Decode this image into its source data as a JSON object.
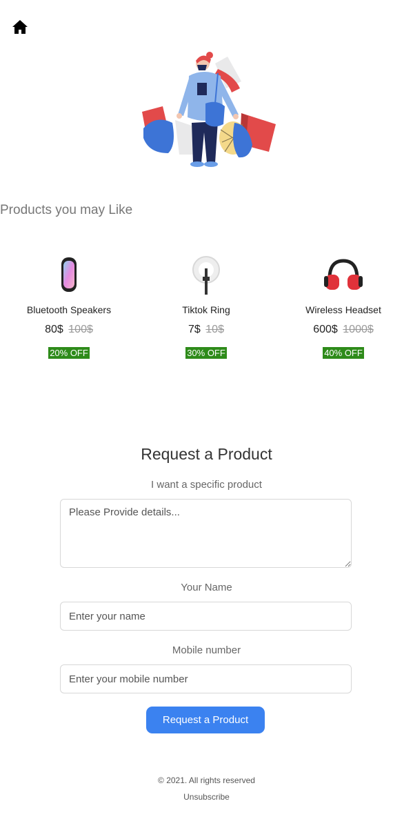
{
  "header": {
    "home_icon": "home-icon"
  },
  "hero": {
    "illustration": "shopping-woman-illustration"
  },
  "products_section": {
    "title": "Products you may Like",
    "items": [
      {
        "name": "Bluetooth Speakers",
        "price": "80$",
        "old_price": "100$",
        "discount": "20% OFF",
        "icon": "speaker-icon"
      },
      {
        "name": "Tiktok Ring",
        "price": "7$",
        "old_price": "10$",
        "discount": "30% OFF",
        "icon": "ring-light-icon"
      },
      {
        "name": "Wireless Headset",
        "price": "600$",
        "old_price": "1000$",
        "discount": "40% OFF",
        "icon": "headset-icon"
      }
    ],
    "badge_color": "#2e8b1a"
  },
  "request_form": {
    "title": "Request a Product",
    "details_label": "I want a specific product",
    "details_placeholder": "Please Provide details...",
    "name_label": "Your Name",
    "name_placeholder": "Enter your name",
    "mobile_label": "Mobile number",
    "mobile_placeholder": "Enter your mobile number",
    "submit_label": "Request a Product",
    "accent": "#3b82f0"
  },
  "footer": {
    "copyright": "© 2021. All rights reserved",
    "unsubscribe": "Unsubscribe"
  }
}
